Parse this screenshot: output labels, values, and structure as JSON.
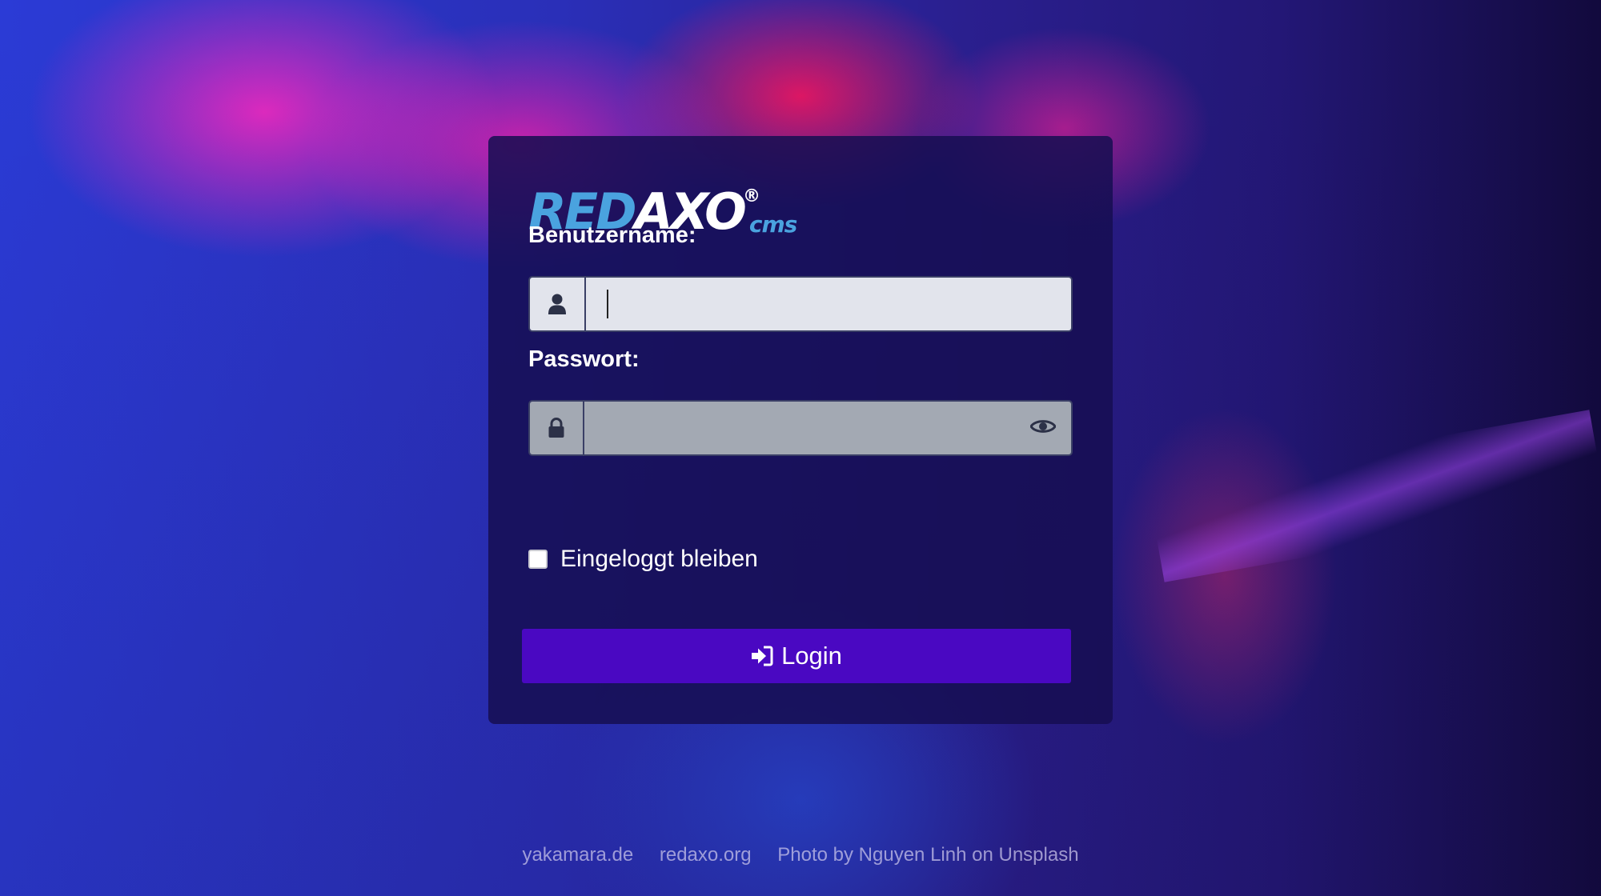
{
  "background": {
    "credit_text": "Photo by Nguyen Linh on Unsplash"
  },
  "logo": {
    "part1": "RED",
    "part2": "AXO",
    "registered": "®",
    "suffix": "cms"
  },
  "form": {
    "username_label": "Benutzername:",
    "username_value": "",
    "password_label": "Passwort:",
    "password_value": "",
    "remember_label": "Eingeloggt bleiben",
    "remember_checked": false,
    "login_label": "Login"
  },
  "icons": {
    "username": "user-icon",
    "password": "lock-icon",
    "reveal": "eye-icon",
    "login": "sign-in-icon"
  },
  "footer": {
    "links": [
      "yakamara.de",
      "redaxo.org",
      "Photo by Nguyen Linh on Unsplash"
    ]
  },
  "colors": {
    "panel_bg": "#160e52",
    "logo_blue": "#4aa3df",
    "button_bg": "#4a08c2",
    "input_bg": "#e2e4ec",
    "password_input_bg": "#a3a9b3"
  }
}
